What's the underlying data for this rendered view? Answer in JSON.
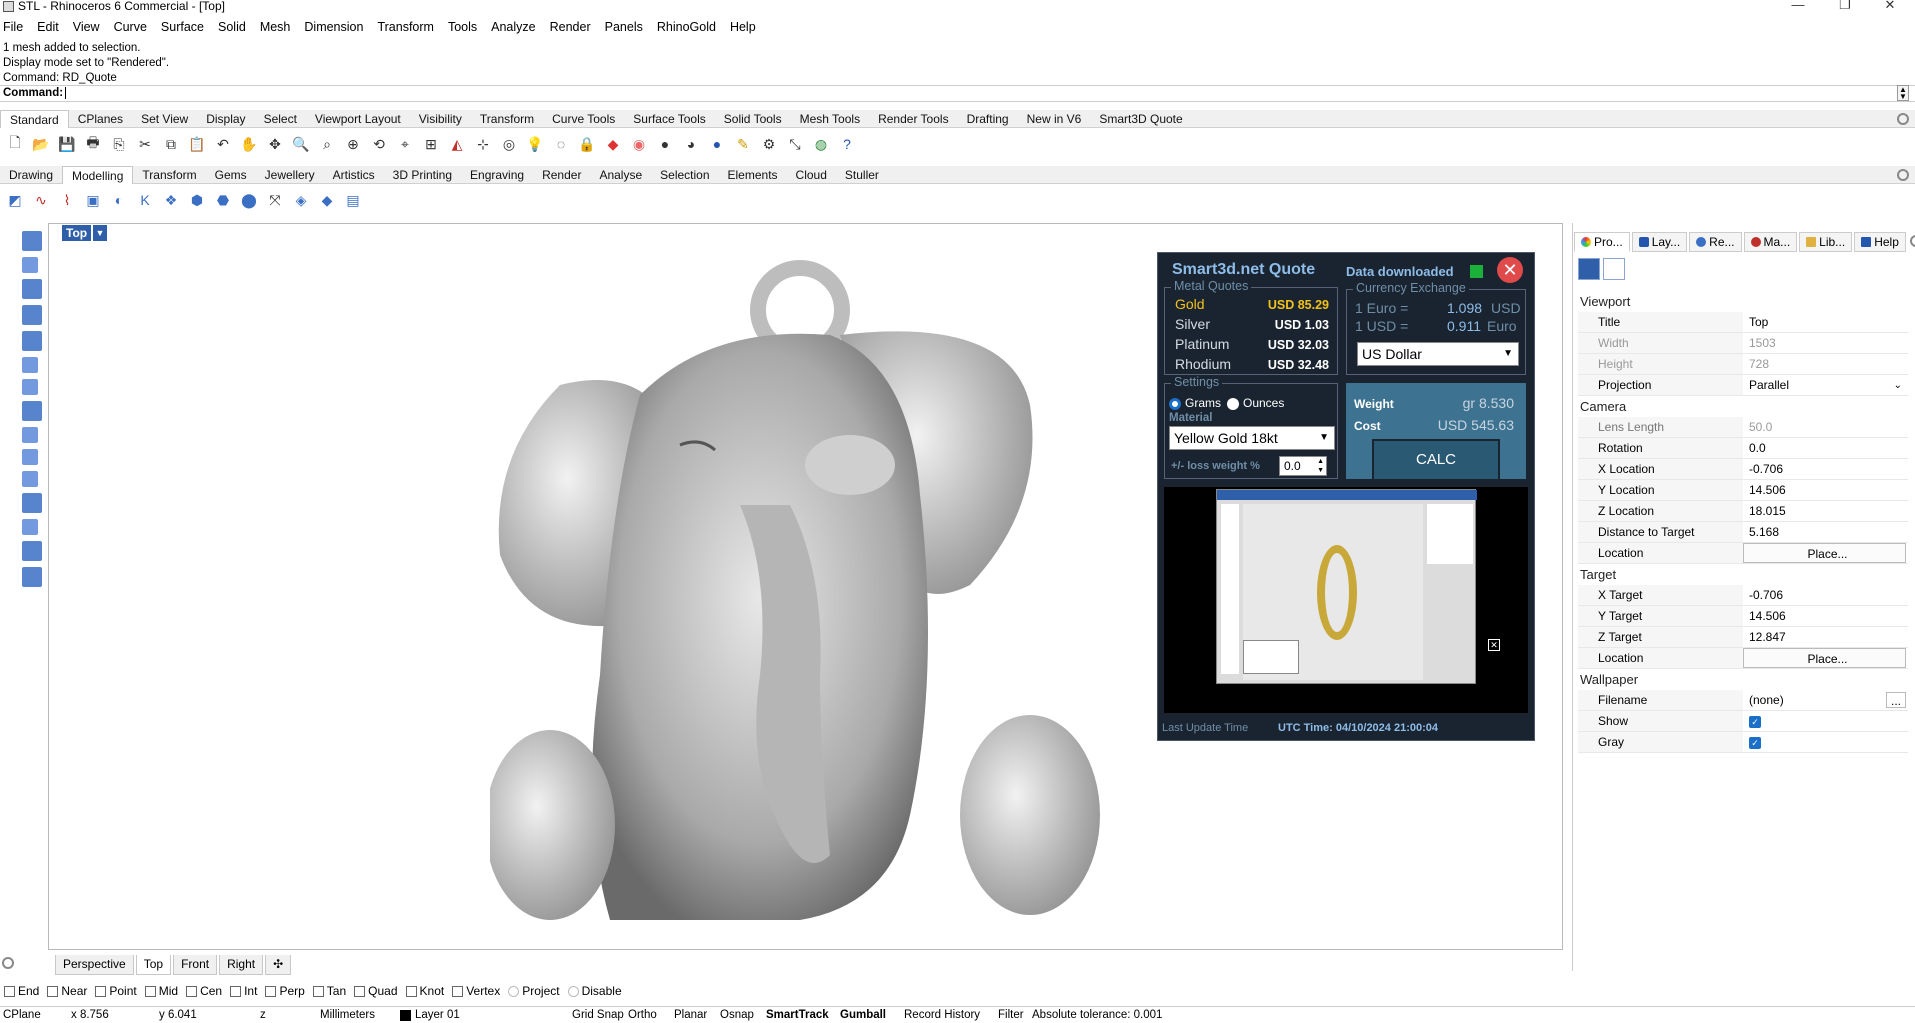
{
  "window": {
    "title": "STL - Rhinoceros 6 Commercial - [Top]",
    "min": "—",
    "max": "❐",
    "close": "✕"
  },
  "menu": [
    "File",
    "Edit",
    "View",
    "Curve",
    "Surface",
    "Solid",
    "Mesh",
    "Dimension",
    "Transform",
    "Tools",
    "Analyze",
    "Render",
    "Panels",
    "RhinoGold",
    "Help"
  ],
  "history": [
    "1 mesh added to selection.",
    "Display mode set to \"Rendered\".",
    "Command: RD_Quote"
  ],
  "command": {
    "label": "Command:",
    "value": ""
  },
  "toolbar_tabs": [
    "Standard",
    "CPlanes",
    "Set View",
    "Display",
    "Select",
    "Viewport Layout",
    "Visibility",
    "Transform",
    "Curve Tools",
    "Surface Tools",
    "Solid Tools",
    "Mesh Tools",
    "Render Tools",
    "Drafting",
    "New in V6",
    "Smart3D Quote"
  ],
  "rhinogold_tabs": [
    "Drawing",
    "Modelling",
    "Transform",
    "Gems",
    "Jewellery",
    "Artistics",
    "3D Printing",
    "Engraving",
    "Render",
    "Analyse",
    "Selection",
    "Elements",
    "Cloud",
    "Stuller"
  ],
  "viewport": {
    "label": "Top"
  },
  "view_tabs": [
    "Perspective",
    "Top",
    "Front",
    "Right"
  ],
  "osnaps": [
    {
      "label": "End",
      "checked": false
    },
    {
      "label": "Near",
      "checked": false
    },
    {
      "label": "Point",
      "checked": false
    },
    {
      "label": "Mid",
      "checked": false
    },
    {
      "label": "Cen",
      "checked": false
    },
    {
      "label": "Int",
      "checked": false
    },
    {
      "label": "Perp",
      "checked": false
    },
    {
      "label": "Tan",
      "checked": false
    },
    {
      "label": "Quad",
      "checked": false
    },
    {
      "label": "Knot",
      "checked": false
    },
    {
      "label": "Vertex",
      "checked": false
    },
    {
      "label": "Project",
      "checked": false
    },
    {
      "label": "Disable",
      "checked": false
    }
  ],
  "status": {
    "cplane": "CPlane",
    "x": "x 8.756",
    "y": "y 6.041",
    "z": "z",
    "units": "Millimeters",
    "layer": "Layer 01",
    "grid_snap": "Grid Snap",
    "ortho": "Ortho",
    "planar": "Planar",
    "osnap": "Osnap",
    "smarttrack": "SmartTrack",
    "gumball": "Gumball",
    "record_history": "Record History",
    "filter": "Filter",
    "tolerance": "Absolute tolerance: 0.001"
  },
  "panel_tabs": [
    "Pro...",
    "Lay...",
    "Re...",
    "Ma...",
    "Lib...",
    "Help"
  ],
  "properties": {
    "viewport_section": "Viewport",
    "title_label": "Title",
    "title_value": "Top",
    "width_label": "Width",
    "width_value": "1503",
    "height_label": "Height",
    "height_value": "728",
    "projection_label": "Projection",
    "projection_value": "Parallel",
    "camera_section": "Camera",
    "lens_label": "Lens Length",
    "lens_value": "50.0",
    "rotation_label": "Rotation",
    "rotation_value": "0.0",
    "xloc_label": "X Location",
    "xloc_value": "-0.706",
    "yloc_label": "Y Location",
    "yloc_value": "14.506",
    "zloc_label": "Z Location",
    "zloc_value": "18.015",
    "dist_label": "Distance to Target",
    "dist_value": "5.168",
    "loc_label": "Location",
    "place_label": "Place...",
    "target_section": "Target",
    "xt_label": "X Target",
    "xt_value": "-0.706",
    "yt_label": "Y Target",
    "yt_value": "14.506",
    "zt_label": "Z Target",
    "zt_value": "12.847",
    "tloc_label": "Location",
    "tplace_label": "Place...",
    "wallpaper_section": "Wallpaper",
    "filename_label": "Filename",
    "filename_value": "(none)",
    "filename_btn": "...",
    "show_label": "Show",
    "gray_label": "Gray"
  },
  "smart3d": {
    "title": "Smart3d.net Quote",
    "status": "Data downloaded",
    "close": "✕",
    "metal_quotes_label": "Metal Quotes",
    "metals": [
      {
        "name": "Gold",
        "value": "USD 85.29"
      },
      {
        "name": "Silver",
        "value": "USD 1.03"
      },
      {
        "name": "Platinum",
        "value": "USD 32.03"
      },
      {
        "name": "Rhodium",
        "value": "USD 32.48"
      }
    ],
    "currency_label": "Currency Exchange",
    "euro_label": "1 Euro =",
    "euro_value": "1.098",
    "euro_unit": "USD",
    "usd_label": "1 USD =",
    "usd_value": "0.911",
    "usd_unit": "Euro",
    "currency_select": "US Dollar",
    "settings_label": "Settings",
    "grams": "Grams",
    "ounces": "Ounces",
    "material_label": "Material",
    "material_select": "Yellow Gold 18kt",
    "loss_label": "+/- loss weight %",
    "loss_value": "0.0",
    "weight_label": "Weight",
    "weight_value": "gr 8.530",
    "cost_label": "Cost",
    "cost_value": "USD  545.63",
    "calc": "CALC",
    "last_update": "Last Update Time",
    "utc_time": "UTC Time: 04/10/2024 21:00:04",
    "colors": {
      "gold": "#f2c21b",
      "accent": "#8ebce8",
      "panel": "#1a2430",
      "calc": "#3d7390"
    }
  }
}
